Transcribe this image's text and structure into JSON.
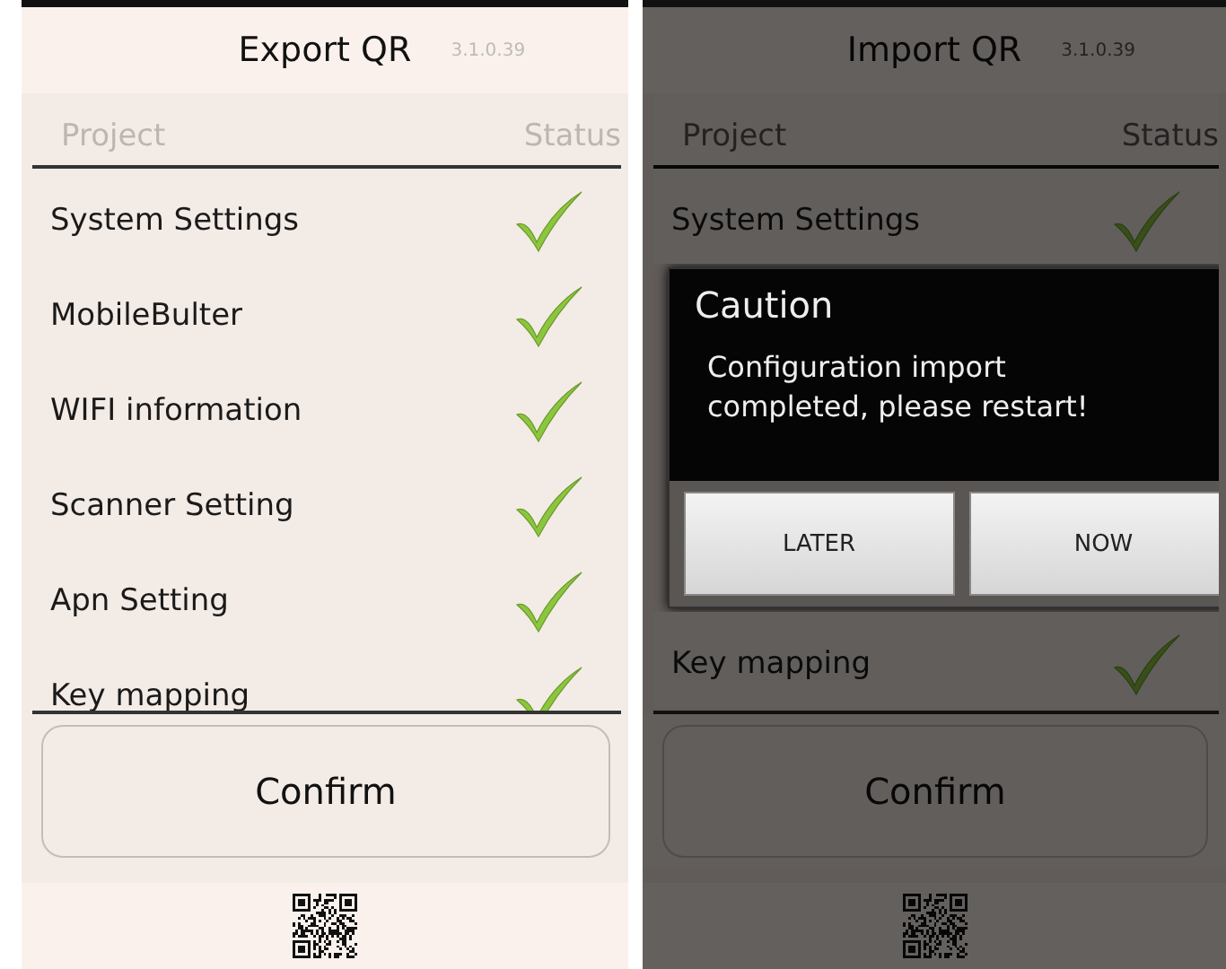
{
  "screens": [
    {
      "title": "Export QR",
      "version": "3.1.0.39",
      "dimmed": false,
      "columns": [
        "Project",
        "Status"
      ],
      "rows": [
        {
          "kind": "item",
          "label": "System Settings",
          "checked": true
        },
        {
          "kind": "item",
          "label": "MobileBulter",
          "checked": true
        },
        {
          "kind": "item",
          "label": "WIFI information",
          "checked": true
        },
        {
          "kind": "item",
          "label": "Scanner Setting",
          "checked": true
        },
        {
          "kind": "item",
          "label": "Apn Setting",
          "checked": true
        },
        {
          "kind": "item",
          "label": "Key mapping",
          "checked": true
        }
      ],
      "confirm": "Confirm"
    },
    {
      "title": "Import QR",
      "version": "3.1.0.39",
      "dimmed": true,
      "columns": [
        "Project",
        "Status"
      ],
      "rows": [
        {
          "kind": "item",
          "label": "System Settings",
          "checked": true
        },
        {
          "kind": "dialog",
          "title": "Caution",
          "message": "Configuration import completed, please restart!",
          "buttons": [
            "LATER",
            "NOW"
          ]
        },
        {
          "kind": "item",
          "label": "Key mapping",
          "checked": true
        }
      ],
      "confirm": "Confirm"
    }
  ]
}
